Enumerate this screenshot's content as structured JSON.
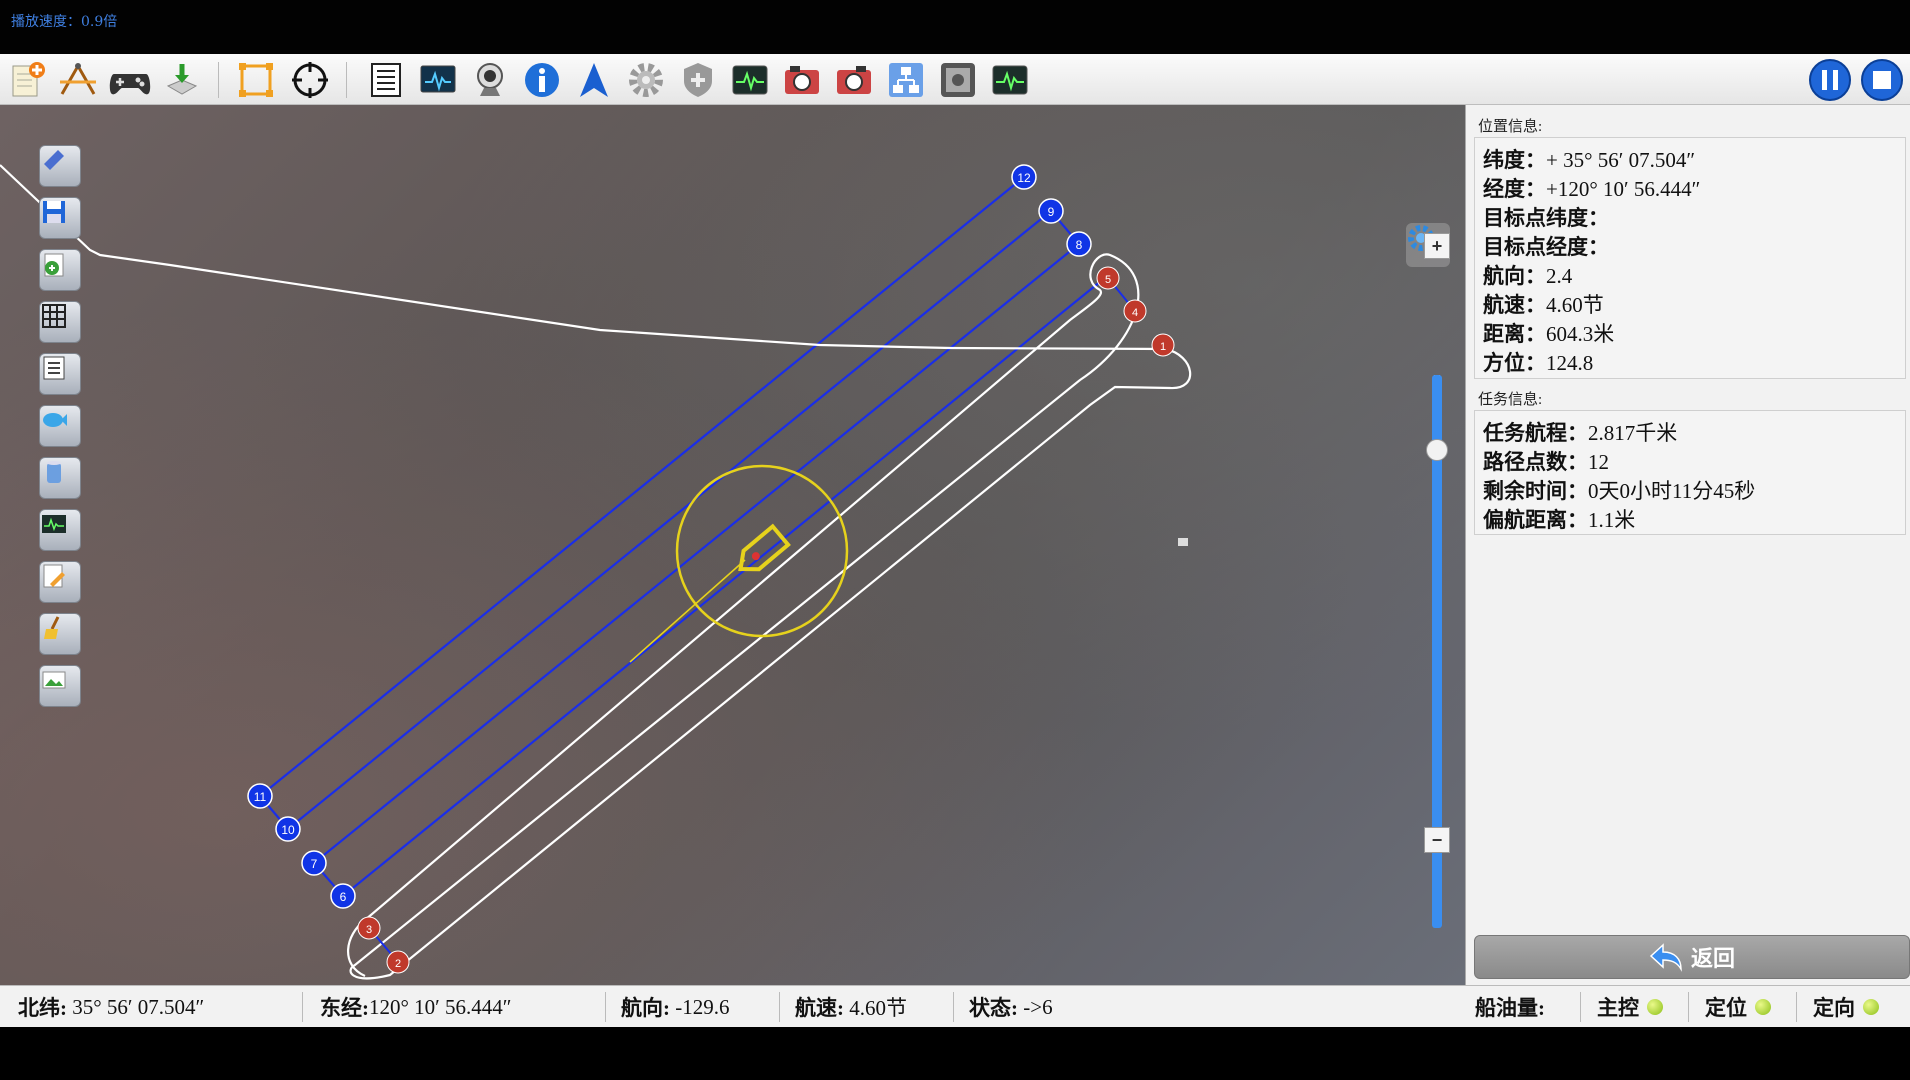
{
  "speed_text": "播放速度：0.9倍",
  "toolbar": {
    "icons": [
      "new-document-icon",
      "route-planning-icon",
      "gamepad-icon",
      "download-icon",
      "fit-extent-icon",
      "target-crosshair-icon",
      "list-icon",
      "monitor-icon",
      "webcam-icon",
      "info-icon",
      "navigation-arrow-icon",
      "settings-gear-icon",
      "shield-icon",
      "waveform-monitor-icon",
      "camera-icon",
      "camera-2-icon",
      "network-icon",
      "screen-capture-icon",
      "waveform-monitor-2-icon"
    ],
    "pause_icon": "pause-icon",
    "stop_icon": "stop-icon"
  },
  "left_tools": [
    "ruler-icon",
    "save-icon",
    "recycle-icon",
    "grid-icon",
    "list-icon",
    "fish-icon",
    "cylinder-icon",
    "chart-icon",
    "edit-icon",
    "broom-icon",
    "image-icon"
  ],
  "map": {
    "waypoints_blue": [
      "12",
      "9",
      "8",
      "11",
      "10",
      "7",
      "6"
    ],
    "waypoints_red": [
      "5",
      "4",
      "1",
      "3",
      "2"
    ]
  },
  "panel": {
    "position_title": "位置信息:",
    "lat_label": "纬度：",
    "lat_value": "+ 35° 56′ 07.504″",
    "lon_label": "经度：",
    "lon_value": "+120° 10′ 56.444″",
    "target_lat_label": "目标点纬度：",
    "target_lon_label": "目标点经度：",
    "heading_label": "航向：",
    "heading_value": "2.4",
    "speed_label": "航速：",
    "speed_value": "4.60节",
    "distance_label": "距离：",
    "distance_value": "604.3米",
    "bearing_label": "方位：",
    "bearing_value": "124.8",
    "task_title": "任务信息:",
    "mission_range_label": "任务航程：",
    "mission_range_value": "2.817千米",
    "waypoint_count_label": "路径点数：",
    "waypoint_count_value": "12",
    "remaining_label": "剩余时间：",
    "remaining_value": "0天0小时11分45秒",
    "offtrack_label": "偏航距离：",
    "offtrack_value": "1.1米",
    "back_label": "返回"
  },
  "status": {
    "lat_label": "北纬:",
    "lat_value": "35° 56′ 07.504″",
    "lon_label": "东经:",
    "lon_value": "120° 10′ 56.444″",
    "heading_label": "航向:",
    "heading_value": "-129.6",
    "speed_label": "航速:",
    "speed_value": "4.60节",
    "state_label": "状态:",
    "state_value": "->6",
    "fuel_label": "船油量:",
    "main_ctrl_label": "主控",
    "positioning_label": "定位",
    "orientation_label": "定向"
  },
  "colors": {
    "route_blue": "#1a2ee8",
    "track_white": "#ffffff",
    "circle_yellow": "#e6d21c",
    "marker_red": "#c0392b",
    "status_ok": "#8bbf17"
  }
}
